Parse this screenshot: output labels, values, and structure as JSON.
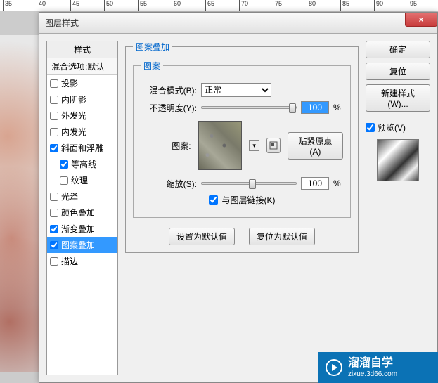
{
  "ruler": {
    "ticks": [
      "35",
      "40",
      "45",
      "50",
      "55",
      "60",
      "65",
      "70",
      "75",
      "80",
      "85",
      "90",
      "95"
    ]
  },
  "dialog": {
    "title": "图层样式",
    "close": "×",
    "styles_header": "样式",
    "blend_default": "混合选项:默认",
    "items": [
      {
        "label": "投影",
        "checked": false,
        "indent": false
      },
      {
        "label": "内阴影",
        "checked": false,
        "indent": false
      },
      {
        "label": "外发光",
        "checked": false,
        "indent": false
      },
      {
        "label": "内发光",
        "checked": false,
        "indent": false
      },
      {
        "label": "斜面和浮雕",
        "checked": true,
        "indent": false
      },
      {
        "label": "等高线",
        "checked": true,
        "indent": true
      },
      {
        "label": "纹理",
        "checked": false,
        "indent": true
      },
      {
        "label": "光泽",
        "checked": false,
        "indent": false
      },
      {
        "label": "颜色叠加",
        "checked": false,
        "indent": false
      },
      {
        "label": "渐变叠加",
        "checked": true,
        "indent": false
      },
      {
        "label": "图案叠加",
        "checked": true,
        "indent": false,
        "selected": true
      },
      {
        "label": "描边",
        "checked": false,
        "indent": false
      }
    ]
  },
  "settings": {
    "group_title": "图案叠加",
    "pattern_group": "图案",
    "blend_mode_label": "混合模式(B):",
    "blend_mode_value": "正常",
    "opacity_label": "不透明度(Y):",
    "opacity_value": "100",
    "percent": "%",
    "pattern_label": "图案:",
    "snap_origin": "贴紧原点(A)",
    "scale_label": "缩放(S):",
    "scale_value": "100",
    "link_layer": "与图层链接(K)",
    "set_default": "设置为默认值",
    "reset_default": "复位为默认值"
  },
  "right": {
    "ok": "确定",
    "reset": "复位",
    "new_style": "新建样式(W)...",
    "preview": "预览(V)"
  },
  "watermark": {
    "title": "溜溜自学",
    "url": "zixue.3d66.com"
  }
}
